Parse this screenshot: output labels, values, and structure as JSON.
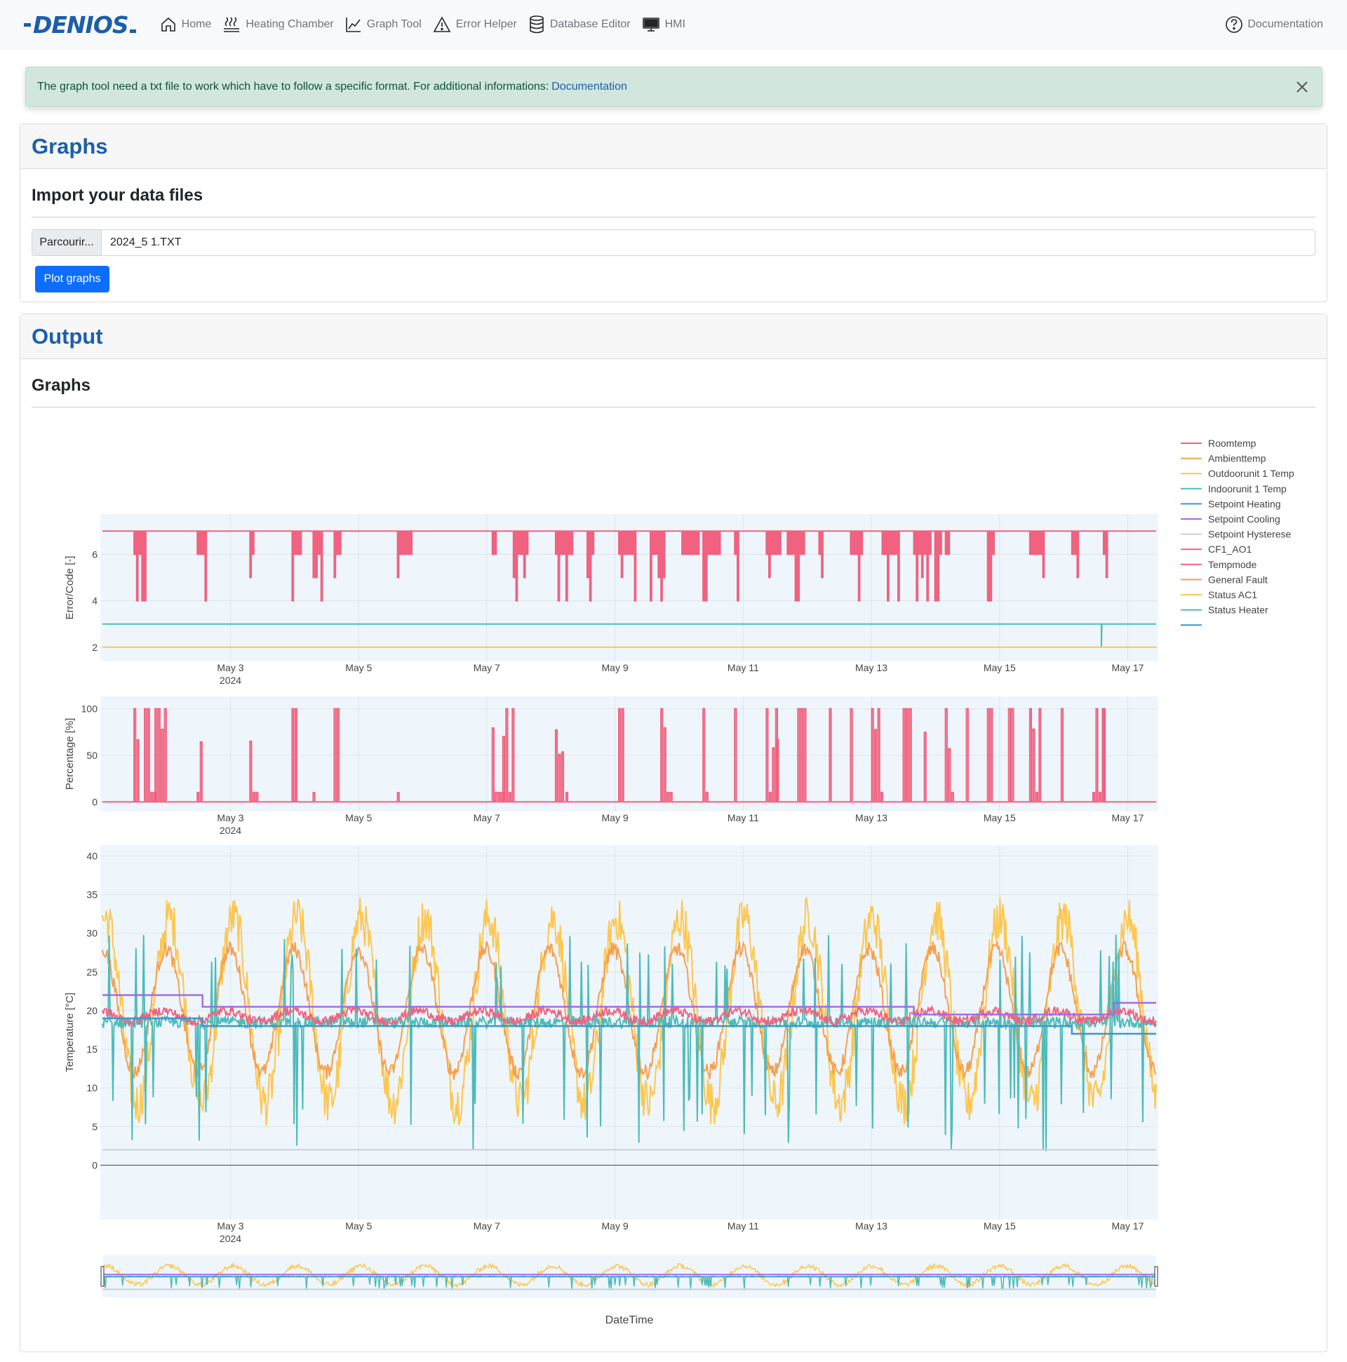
{
  "navbar": {
    "brand": "DENIOS",
    "items": [
      {
        "label": "Home",
        "icon": "house-icon"
      },
      {
        "label": "Heating Chamber",
        "icon": "heat-icon"
      },
      {
        "label": "Graph Tool",
        "icon": "chart-line-icon"
      },
      {
        "label": "Error Helper",
        "icon": "warning-icon"
      },
      {
        "label": "Database Editor",
        "icon": "database-icon"
      },
      {
        "label": "HMI",
        "icon": "monitor-icon"
      }
    ],
    "documentation": "Documentation"
  },
  "alert": {
    "text": "The graph tool need a txt file to work which have to follow a specific format. For additional informations:",
    "link": "Documentation"
  },
  "graphs_card": {
    "title": "Graphs",
    "import_heading": "Import your data files",
    "browse_label": "Parcourir...",
    "file_name": "2024_5 1.TXT",
    "plot_button": "Plot graphs"
  },
  "output_card": {
    "title": "Output",
    "graphs_heading": "Graphs"
  },
  "colors": {
    "red": "#f0627f",
    "orange": "#f6a04d",
    "yellow": "#fdc74f",
    "teal": "#4dbbba",
    "blue": "#3c97c8",
    "purple": "#a56ae6",
    "gray": "#c9ced4",
    "plot_bg": "#eef6fc",
    "brand": "#1d5ea8"
  },
  "chart_data": [
    {
      "type": "line",
      "ylabel": "Error/Code [-]",
      "ylim": [
        1.6,
        7.4
      ],
      "yticks": [
        2,
        4,
        6
      ],
      "xticks": [
        "May 3",
        "May 5",
        "May 7",
        "May 9",
        "May 11",
        "May 13",
        "May 15",
        "May 17"
      ],
      "xticks_year": "2024",
      "series": [
        {
          "name": "CF1_AO1",
          "color": "#f0627f",
          "base": 7,
          "low": [
            6,
            5,
            4
          ]
        },
        {
          "name": "Status Heater",
          "color": "#4dbbba",
          "constant": 3
        },
        {
          "name": "Status AC1",
          "color": "#fdc74f",
          "constant": 2
        }
      ]
    },
    {
      "type": "line",
      "ylabel": "Percentage [%]",
      "ylim": [
        -5,
        105
      ],
      "yticks": [
        0,
        50,
        100
      ],
      "xticks": [
        "May 3",
        "May 5",
        "May 7",
        "May 9",
        "May 11",
        "May 13",
        "May 15",
        "May 17"
      ],
      "xticks_year": "2024",
      "series": [
        {
          "name": "Tempmode",
          "color": "#f0627f",
          "base": 0,
          "spikes": [
            100,
            50,
            10
          ]
        }
      ]
    },
    {
      "type": "line",
      "ylabel": "Temperature [°C]",
      "xlabel": "DateTime",
      "ylim": [
        -3.5,
        40.5
      ],
      "yticks": [
        0,
        5,
        10,
        15,
        20,
        25,
        30,
        35,
        40
      ],
      "xticks": [
        "May 3",
        "May 5",
        "May 7",
        "May 9",
        "May 11",
        "May 13",
        "May 15",
        "May 17"
      ],
      "xticks_year": "2024",
      "series": [
        {
          "name": "Roomtemp",
          "color": "#f0627f"
        },
        {
          "name": "Ambienttemp",
          "color": "#f6a04d"
        },
        {
          "name": "Outdoorunit 1 Temp",
          "color": "#fdc74f"
        },
        {
          "name": "Indoorunit 1 Temp",
          "color": "#4dbbba"
        },
        {
          "name": "Setpoint Heating",
          "color": "#3c97c8",
          "steps": [
            [
              0,
              19
            ],
            [
              0.095,
              18
            ],
            [
              0.92,
              17
            ]
          ]
        },
        {
          "name": "Setpoint Cooling",
          "color": "#a56ae6",
          "steps": [
            [
              0,
              22
            ],
            [
              0.095,
              20.5
            ],
            [
              0.77,
              19.5
            ],
            [
              0.96,
              21
            ]
          ]
        },
        {
          "name": "Setpoint Hysterese",
          "color": "#c9ced4",
          "constant": 2
        }
      ]
    }
  ],
  "legend": {
    "placement": "right",
    "entries": [
      {
        "label": "Roomtemp",
        "color": "#f0627f"
      },
      {
        "label": "Ambienttemp",
        "color": "#f6a04d"
      },
      {
        "label": "Outdoorunit 1 Temp",
        "color": "#fdc74f"
      },
      {
        "label": "Indoorunit 1 Temp",
        "color": "#4dbbba"
      },
      {
        "label": "Setpoint Heating",
        "color": "#3c97c8"
      },
      {
        "label": "Setpoint Cooling",
        "color": "#a56ae6"
      },
      {
        "label": "Setpoint Hysterese",
        "color": "#c9ced4"
      },
      {
        "label": "CF1_AO1",
        "color": "#f0627f"
      },
      {
        "label": "Tempmode",
        "color": "#f0627f"
      },
      {
        "label": "General Fault",
        "color": "#f6a04d"
      },
      {
        "label": "Status AC1",
        "color": "#fdc74f"
      },
      {
        "label": "Status Heater",
        "color": "#4dbbba"
      },
      {
        "label": "",
        "color": "#3c97c8"
      }
    ]
  }
}
